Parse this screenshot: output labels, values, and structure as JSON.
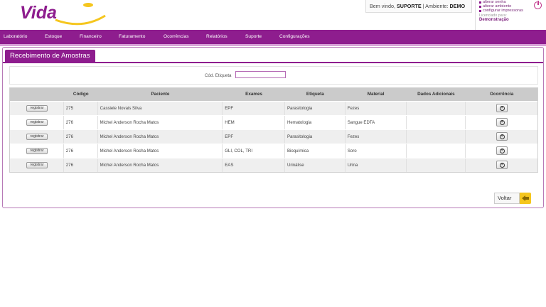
{
  "header": {
    "logo_text": "Vida",
    "welcome_prefix": "Bem vindo,",
    "user": "SUPORTE",
    "env_prefix": "| Ambiente:",
    "env": "DEMO",
    "links": [
      "alterar senha",
      "alterar ambiente",
      "configurar impressoras"
    ],
    "licensed_label": "Licenciado para:",
    "licensed_to": "Demonstração"
  },
  "nav": {
    "items": [
      "Laboratório",
      "Estoque",
      "Financeiro",
      "Faturamento",
      "Ocorrências",
      "Relatórios",
      "Suporte",
      "Configurações"
    ]
  },
  "page": {
    "title": "Recebimento de Amostras",
    "search_label": "Cód. Etiqueta",
    "search_value": "",
    "back_label": "Voltar"
  },
  "table": {
    "headers": [
      "",
      "Código",
      "Paciente",
      "Exames",
      "Etiqueta",
      "Material",
      "Dados Adicionais",
      "Ocorrência"
    ],
    "register_label": "registrar",
    "occurrence_symbol": "+",
    "rows": [
      [
        "275",
        "Cassiele Novais Silva",
        "EPF",
        "Parasitologia",
        "Fezes",
        ""
      ],
      [
        "276",
        "Michel Anderson Rocha Matos",
        "HEM",
        "Hematologia",
        "Sangue EDTA",
        ""
      ],
      [
        "276",
        "Michel Anderson Rocha Matos",
        "EPF",
        "Parasitologia",
        "Fezes",
        ""
      ],
      [
        "276",
        "Michel Anderson Rocha Matos",
        "GLI, COL, TRI",
        "Bioquímica",
        "Soro",
        ""
      ],
      [
        "276",
        "Michel Anderson Rocha Matos",
        "EAS",
        "Urinálise",
        "Urina",
        ""
      ]
    ]
  },
  "colors": {
    "brand": "#8e1d8e",
    "logo_yellow": "#f5c61e",
    "accent_light": "#d8a2d8"
  }
}
